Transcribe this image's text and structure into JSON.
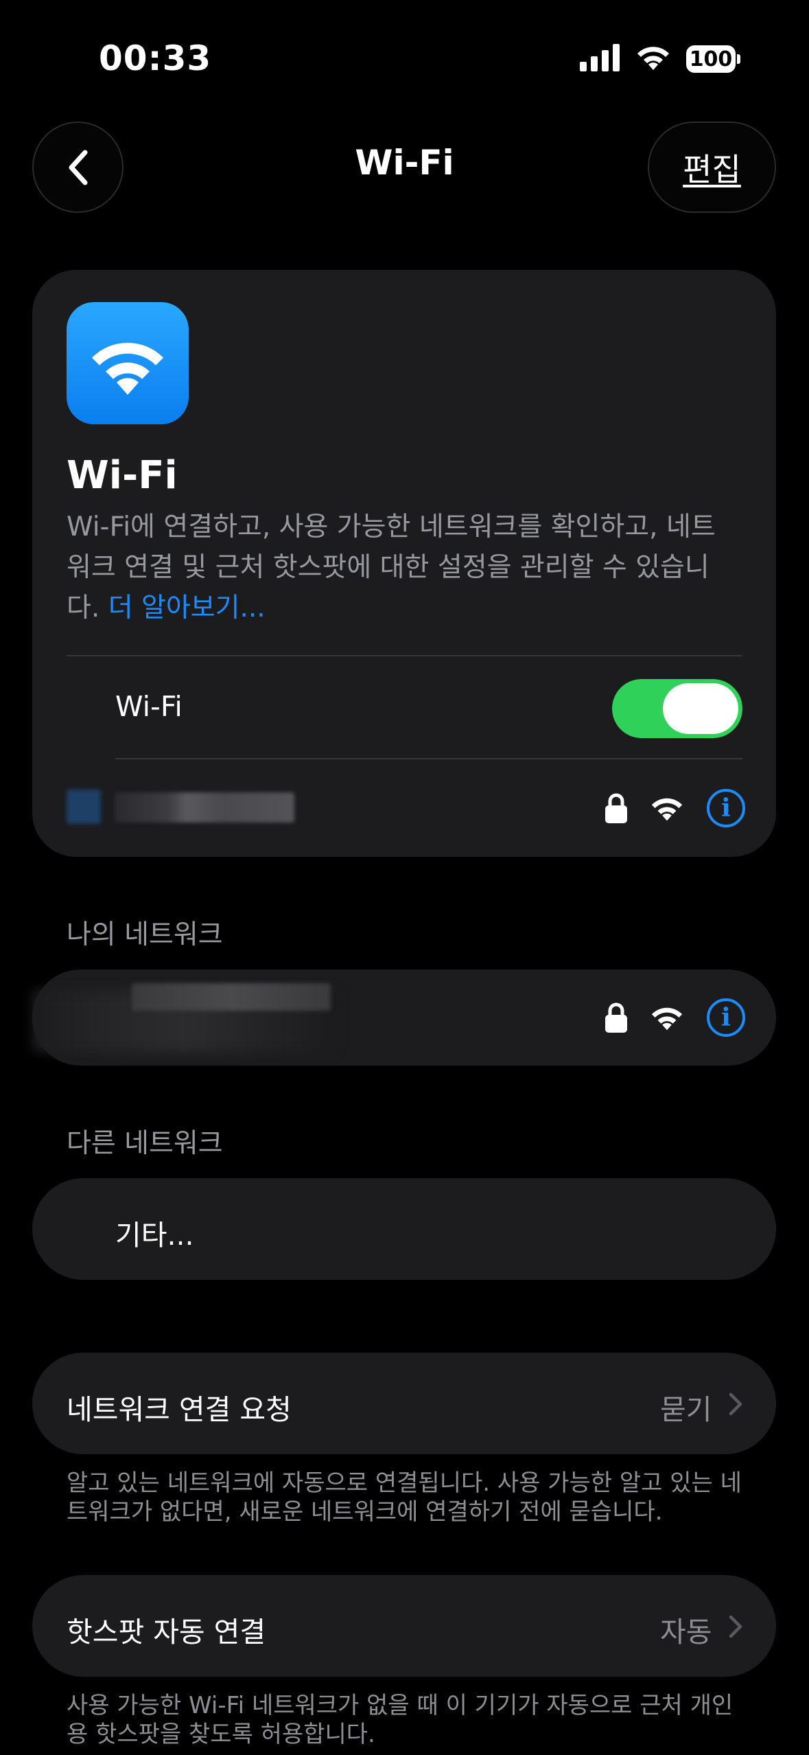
{
  "status_bar": {
    "time": "00:33",
    "battery": "100"
  },
  "nav": {
    "title": "Wi-Fi",
    "edit_label": "편집"
  },
  "header_card": {
    "title": "Wi-Fi",
    "description": "Wi-Fi에 연결하고, 사용 가능한 네트워크를 확인하고, 네트워크 연결 및 근처 핫스팟에 대한 설정을 관리할 수 있습니다.",
    "learn_more": "더 알아보기...",
    "wifi_toggle_label": "Wi-Fi",
    "wifi_enabled": true
  },
  "my_networks": {
    "header": "나의 네트워크"
  },
  "other_networks": {
    "header": "다른 네트워크",
    "other_label": "기타..."
  },
  "ask_to_join": {
    "label": "네트워크 연결 요청",
    "value": "묻기",
    "footnote": "알고 있는 네트워크에 자동으로 연결됩니다. 사용 가능한 알고 있는 네트워크가 없다면, 새로운 네트워크에 연결하기 전에 묻습니다."
  },
  "auto_hotspot": {
    "label": "핫스팟 자동 연결",
    "value": "자동",
    "footnote": "사용 가능한 Wi-Fi 네트워크가 없을 때 이 기기가 자동으로 근처 개인용 핫스팟을 찾도록 허용합니다."
  },
  "colors": {
    "accent": "#1a8cff",
    "toggle_on": "#30d158",
    "card_bg": "#1c1c1e"
  }
}
